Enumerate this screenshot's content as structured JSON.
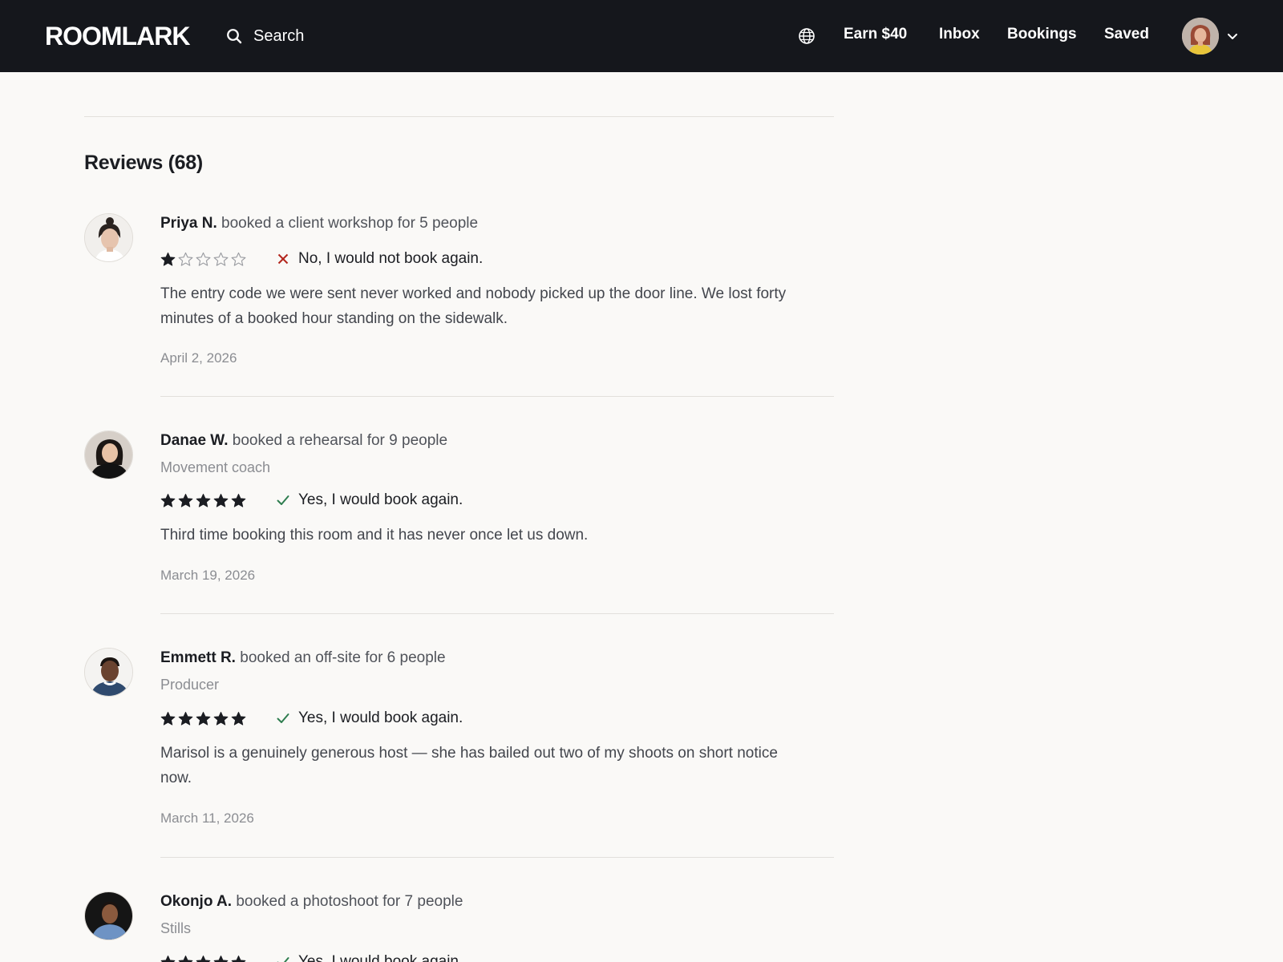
{
  "header": {
    "logo": "ROOMLARK",
    "search_label": "Search",
    "nav": {
      "earn": "Earn $40",
      "inbox": "Inbox",
      "bookings": "Bookings",
      "saved": "Saved"
    }
  },
  "reviews_section": {
    "title": "Reviews (68)",
    "reviews": [
      {
        "name": "Priya N.",
        "booking": "booked a client workshop for 5 people",
        "role": "",
        "rating": 1,
        "rating_max": 5,
        "would_book_again": false,
        "verdict": "No, I would not book again.",
        "body": "The entry code we were sent never worked and nobody picked up the door line. We lost forty minutes of a booked hour standing on the sidewalk.",
        "date": "April 2, 2026"
      },
      {
        "name": "Danae W.",
        "booking": "booked a rehearsal for 9 people",
        "role": "Movement coach",
        "rating": 5,
        "rating_max": 5,
        "would_book_again": true,
        "verdict": "Yes, I would book again.",
        "body": "Third time booking this room and it has never once let us down.",
        "date": "March 19, 2026"
      },
      {
        "name": "Emmett R.",
        "booking": "booked an off-site for 6 people",
        "role": "Producer",
        "rating": 5,
        "rating_max": 5,
        "would_book_again": true,
        "verdict": "Yes, I would book again.",
        "body": "Marisol is a genuinely generous host — she has bailed out two of my shoots on short notice now.",
        "date": "March 11, 2026"
      },
      {
        "name": "Okonjo A.",
        "booking": "booked a photoshoot for 7 people",
        "role": "Stills",
        "rating": 5,
        "rating_max": 5,
        "would_book_again": true,
        "verdict": "Yes, I would book again.",
        "body": "",
        "date": ""
      }
    ]
  },
  "colors": {
    "header_bg": "#15171c",
    "page_bg": "#faf9f7",
    "negative": "#b3261e",
    "positive": "#2e7d4f"
  },
  "icons": {
    "search": "search-icon",
    "globe": "globe-icon",
    "chevron": "chevron-down-icon",
    "star_filled": "star-filled-icon",
    "star_empty": "star-empty-icon",
    "check": "check-icon",
    "cross": "x-icon"
  }
}
